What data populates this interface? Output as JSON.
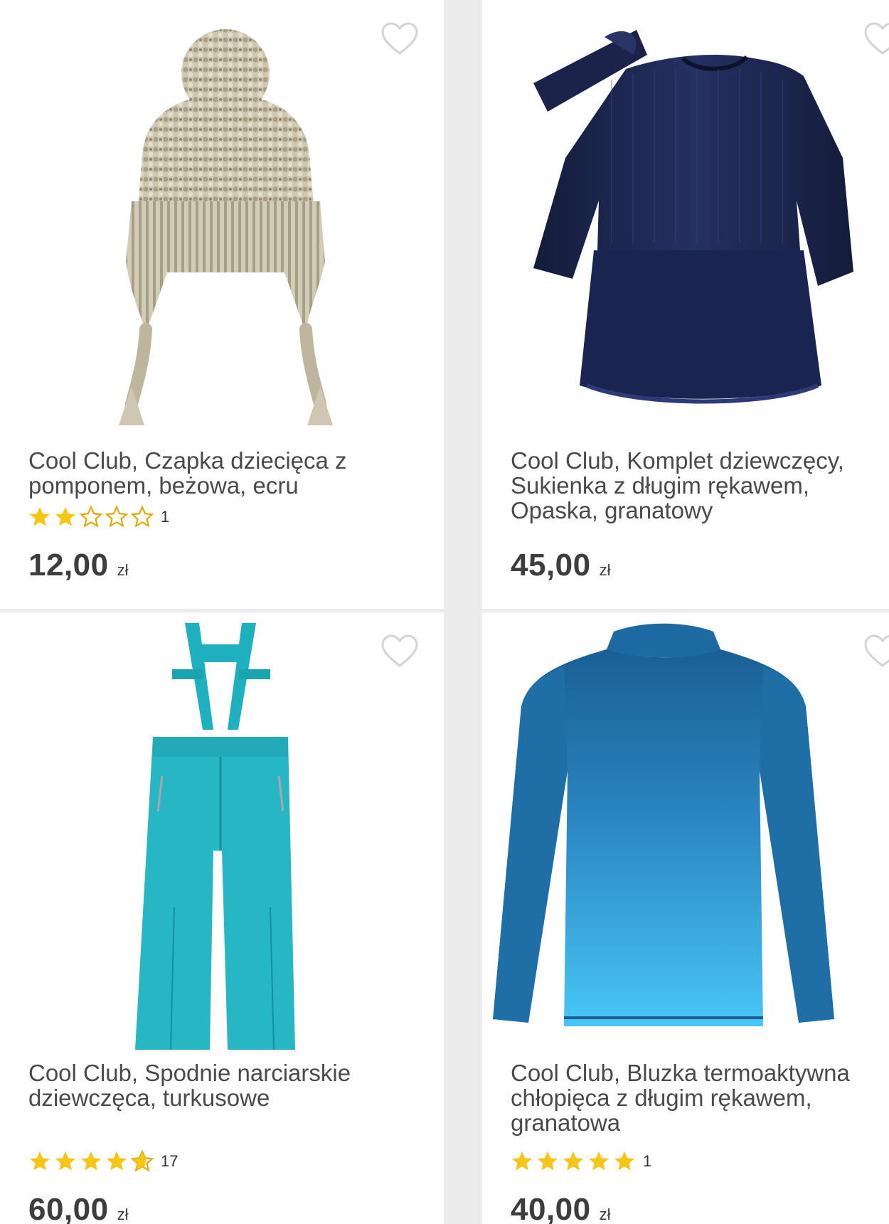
{
  "products": [
    {
      "title": "Cool Club, Czapka dziecięca z pomponem, beżowa, ecru",
      "image_icon": "knit-hat-icon",
      "rating": 2,
      "rating_max": 5,
      "review_count": "1",
      "price": "12,00",
      "currency": "zł"
    },
    {
      "title": "Cool Club, Komplet dziewczęcy, Sukienka z długim rękawem, Opaska, granatowy",
      "image_icon": "dress-headband-icon",
      "price": "45,00",
      "currency": "zł"
    },
    {
      "title": "Cool Club, Spodnie narciarskie dziewczęca, turkusowe",
      "image_icon": "ski-pants-icon",
      "rating": 4.5,
      "rating_max": 5,
      "review_count": "17",
      "price": "60,00",
      "currency": "zł"
    },
    {
      "title": "Cool Club, Bluzka termoaktywna chłopięca z długim rękawem, granatowa",
      "image_icon": "long-sleeve-shirt-icon",
      "rating": 5,
      "rating_max": 5,
      "review_count": "1",
      "price": "40,00",
      "currency": "zł"
    }
  ],
  "colors": {
    "star": "#f5c518",
    "star_empty_stroke": "#e0a800",
    "text": "#4a4a4a",
    "price": "#3d3d3d",
    "divider": "#ececec"
  }
}
